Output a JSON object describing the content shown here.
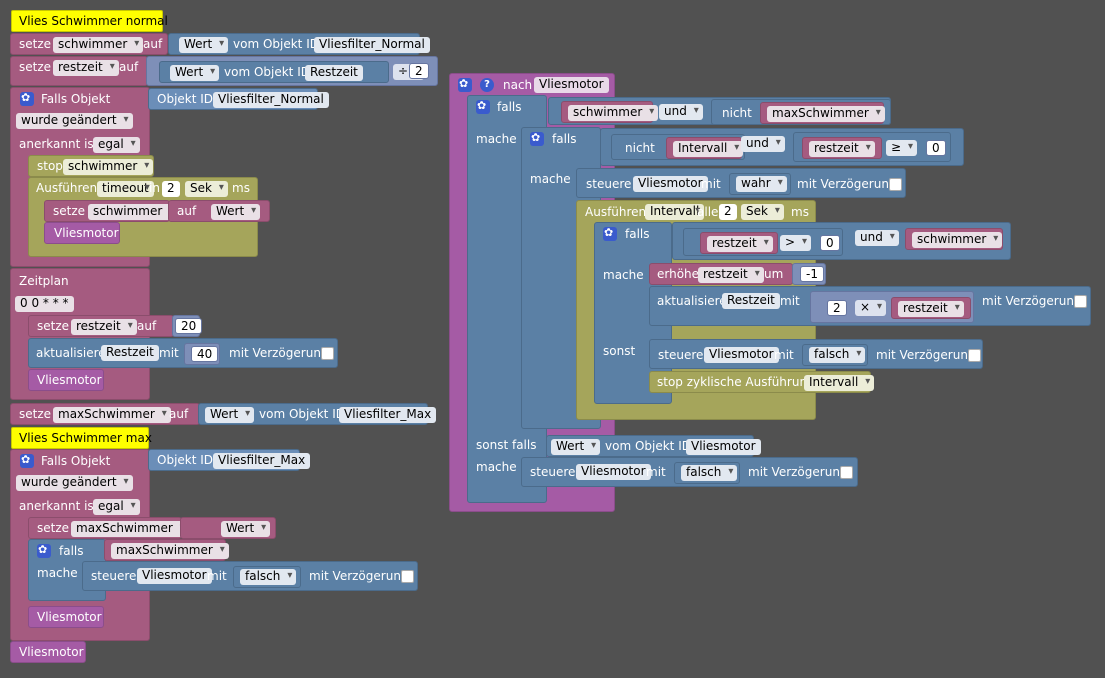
{
  "left": {
    "comment1": "Vlies Schwimmer normal",
    "setze1": {
      "kw": "setze",
      "var": "schwimmer",
      "auf": "auf",
      "wert": "Wert",
      "vom": "vom Objekt ID",
      "id": "Vliesfilter_Normal"
    },
    "setze2": {
      "kw": "setze",
      "var": "restzeit",
      "auf": "auf",
      "wert": "Wert",
      "vom": "vom Objekt ID",
      "id": "Restzeit",
      "op": "÷",
      "num": "2"
    },
    "trig1": {
      "label": "Falls Objekt",
      "objid_label": "Objekt ID",
      "objid": "Vliesfilter_Normal",
      "changed": "wurde geändert",
      "ack_label": "anerkannt ist",
      "ack": "egal"
    },
    "stop1": {
      "kw": "stop",
      "var": "schwimmer"
    },
    "timeout1": {
      "kw": "Ausführen",
      "var": "timeout",
      "in": "in",
      "num": "2",
      "unit": "Sek",
      "ms": "ms"
    },
    "setze3": {
      "kw": "setze",
      "var": "schwimmer",
      "auf": "auf",
      "wert": "Wert"
    },
    "call1": "Vliesmotor",
    "zeitplan": {
      "label": "Zeitplan",
      "cron": "0 0 * * *"
    },
    "setze4": {
      "kw": "setze",
      "var": "restzeit",
      "auf": "auf",
      "num": "20"
    },
    "akt1": {
      "kw": "aktualisiere",
      "id": "Restzeit",
      "mit": "mit",
      "num": "40",
      "delay": "mit Verzögerung"
    },
    "call2": "Vliesmotor",
    "setze5": {
      "kw": "setze",
      "var": "maxSchwimmer",
      "auf": "auf",
      "wert": "Wert",
      "vom": "vom Objekt ID",
      "id": "Vliesfilter_Max"
    },
    "comment2": "Vlies Schwimmer max",
    "trig2": {
      "label": "Falls Objekt",
      "objid_label": "Objekt ID",
      "objid": "Vliesfilter_Max",
      "changed": "wurde geändert",
      "ack_label": "anerkannt ist",
      "ack": "egal"
    },
    "setze6": {
      "kw": "setze",
      "var": "maxSchwimmer",
      "auf": "auf",
      "wert": "Wert"
    },
    "if1": {
      "falls": "falls",
      "var": "maxSchwimmer",
      "mache": "mache",
      "steuere": "steuere",
      "id": "Vliesmotor",
      "mit": "mit",
      "val": "falsch",
      "delay": "mit Verzögerung"
    },
    "call3": "Vliesmotor",
    "call4": "Vliesmotor"
  },
  "right": {
    "nach": "nach",
    "func": "Vliesmotor",
    "falls": "falls",
    "var_schwimmer": "schwimmer",
    "und": "und",
    "nicht": "nicht",
    "var_max": "maxSchwimmer",
    "mache": "mache",
    "falls2": "falls",
    "nicht2": "nicht",
    "var_intervall": "Intervall",
    "und2": "und",
    "var_restzeit": "restzeit",
    "op_ge": "≥",
    "zero": "0",
    "steuere1": {
      "kw": "steuere",
      "id": "Vliesmotor",
      "mit": "mit",
      "val": "wahr",
      "delay": "mit Verzögerung"
    },
    "interval": {
      "kw": "Ausführen",
      "var": "Intervall",
      "alle": "alle",
      "num": "2",
      "unit": "Sek",
      "ms": "ms"
    },
    "falls3": "falls",
    "op_gt": ">",
    "zero2": "0",
    "und3": "und",
    "var_schwimmer2": "schwimmer",
    "mache3": "mache",
    "erhoehe": {
      "kw": "erhöhe",
      "var": "restzeit",
      "um": "um",
      "num": "-1"
    },
    "akt2": {
      "kw": "aktualisiere",
      "id": "Restzeit",
      "mit": "mit",
      "num": "2",
      "op": "×",
      "var": "restzeit",
      "delay": "mit Verzögerung"
    },
    "sonst": "sonst",
    "steuere2": {
      "kw": "steuere",
      "id": "Vliesmotor",
      "mit": "mit",
      "val": "falsch",
      "delay": "mit Verzögerung"
    },
    "stopint": {
      "kw": "stop zyklische Ausführung",
      "var": "Intervall"
    },
    "sonstfalls": "sonst falls",
    "wert": "Wert",
    "vom": "vom Objekt ID",
    "id": "Vliesmotor",
    "mache4": "mache",
    "steuere3": {
      "kw": "steuere",
      "id": "Vliesmotor",
      "mit": "mit",
      "val": "falsch",
      "delay": "mit Verzögerung"
    }
  }
}
